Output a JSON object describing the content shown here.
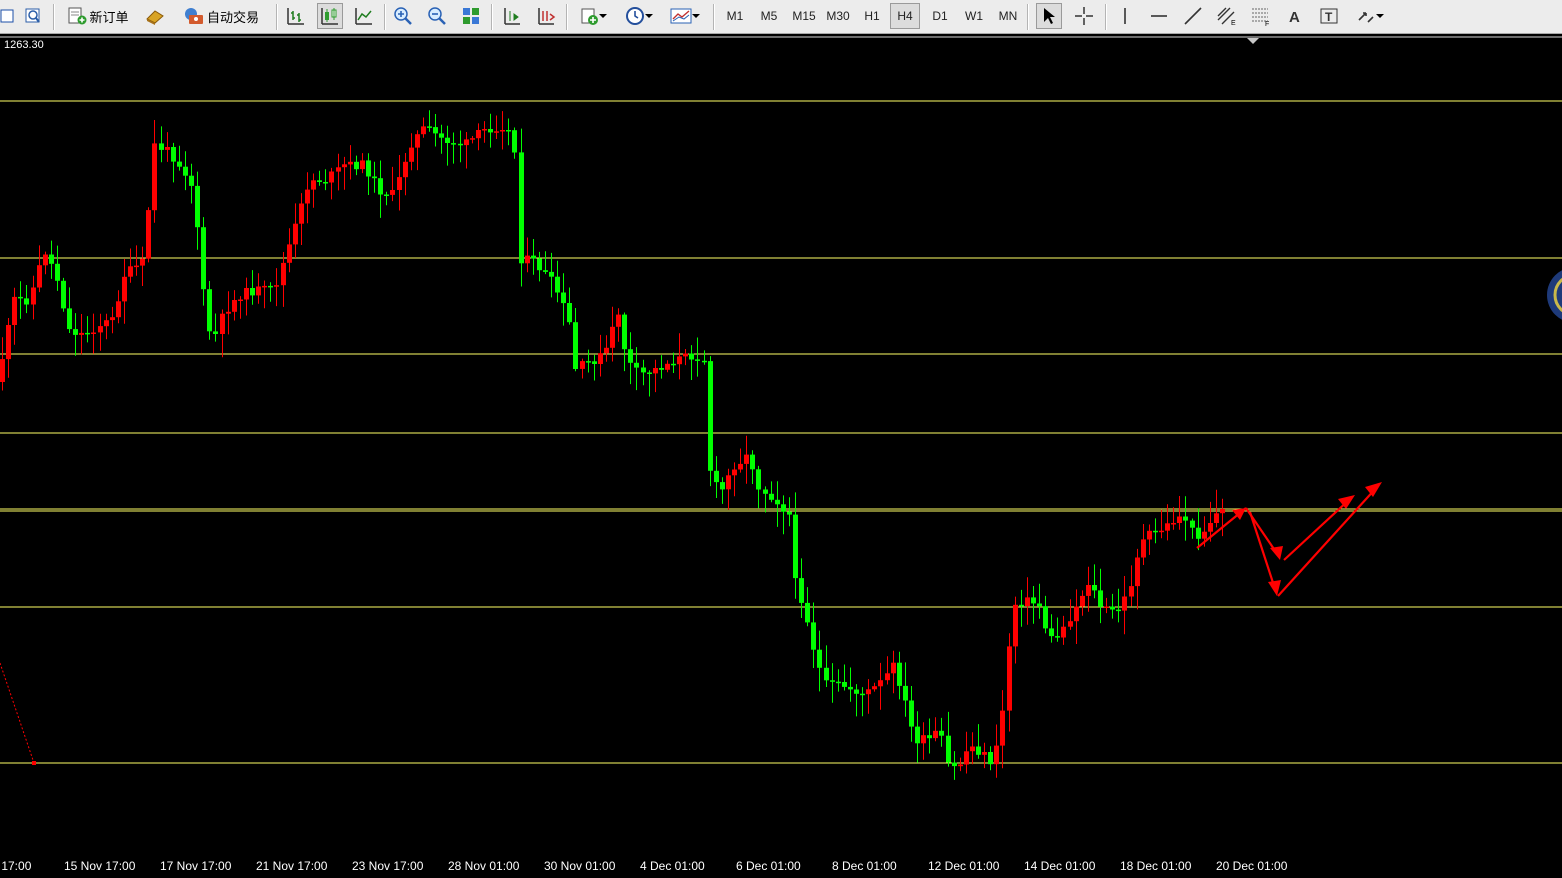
{
  "toolbar": {
    "new_order_label": "新订单",
    "auto_trade_label": "自动交易",
    "timeframes": [
      "M1",
      "M5",
      "M15",
      "M30",
      "H1",
      "H4",
      "D1",
      "W1",
      "MN"
    ],
    "active_timeframe": "H4"
  },
  "chart": {
    "price_label": "1263.30",
    "colors": {
      "up": "#ff0000",
      "down": "#00ff00",
      "level": "#ffff66",
      "background": "#000000",
      "arrow": "#ff0000"
    },
    "x_labels": [
      "v 17:00",
      "15 Nov 17:00",
      "17 Nov 17:00",
      "21 Nov 17:00",
      "23 Nov 17:00",
      "28 Nov 01:00",
      "30 Nov 01:00",
      "4 Dec 01:00",
      "6 Dec 01:00",
      "8 Dec 01:00",
      "12 Dec 01:00",
      "14 Dec 01:00",
      "18 Dec 01:00",
      "20 Dec 01:00"
    ]
  }
}
